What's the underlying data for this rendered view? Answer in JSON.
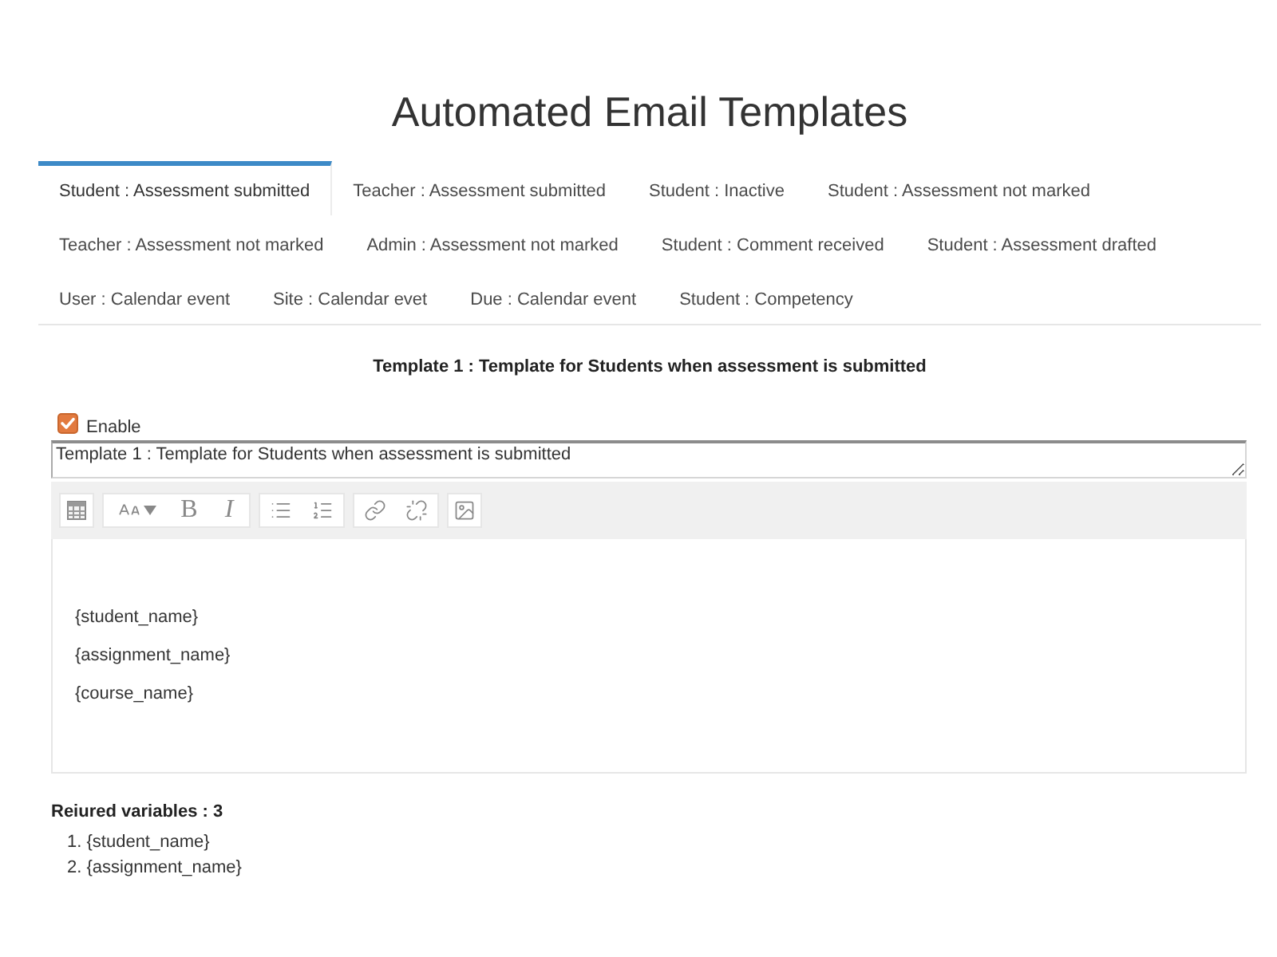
{
  "title": "Automated Email Templates",
  "tabs": [
    {
      "label": "Student : Assessment submitted",
      "selected": true
    },
    {
      "label": "Teacher : Assessment submitted",
      "selected": false
    },
    {
      "label": "Student : Inactive",
      "selected": false
    },
    {
      "label": "Student : Assessment not marked",
      "selected": false
    },
    {
      "label": "Teacher : Assessment not marked",
      "selected": false
    },
    {
      "label": "Admin : Assessment not marked",
      "selected": false
    },
    {
      "label": "Student : Comment received",
      "selected": false
    },
    {
      "label": "Student : Assessment drafted",
      "selected": false
    },
    {
      "label": "User : Calendar event",
      "selected": false
    },
    {
      "label": "Site : Calendar evet",
      "selected": false
    },
    {
      "label": "Due : Calendar event",
      "selected": false
    },
    {
      "label": "Student : Competency",
      "selected": false
    }
  ],
  "template": {
    "heading": "Template 1 : Template for Students when assessment is submitted",
    "enable": {
      "label": "Enable",
      "checked": true
    },
    "subject": {
      "value": "Template 1 : Template for Students when assessment is submitted"
    },
    "toolbar": [
      {
        "buttons": [
          {
            "kind": "template"
          }
        ]
      },
      {
        "buttons": [
          {
            "kind": "font_size"
          },
          {
            "kind": "bold",
            "glyph": "B"
          },
          {
            "kind": "italic",
            "glyph": "I"
          }
        ]
      },
      {
        "buttons": [
          {
            "kind": "bullet_list"
          },
          {
            "kind": "numbered_list"
          }
        ]
      },
      {
        "buttons": [
          {
            "kind": "link"
          },
          {
            "kind": "unlink"
          }
        ]
      },
      {
        "buttons": [
          {
            "kind": "image"
          }
        ]
      }
    ],
    "body": [
      "{student_name}",
      "{assignment_name}",
      "{course_name}"
    ]
  },
  "required_variables": {
    "heading": "Reiured variables : 3",
    "items": [
      "1. {student_name}",
      "2. {assignment_name}"
    ]
  }
}
